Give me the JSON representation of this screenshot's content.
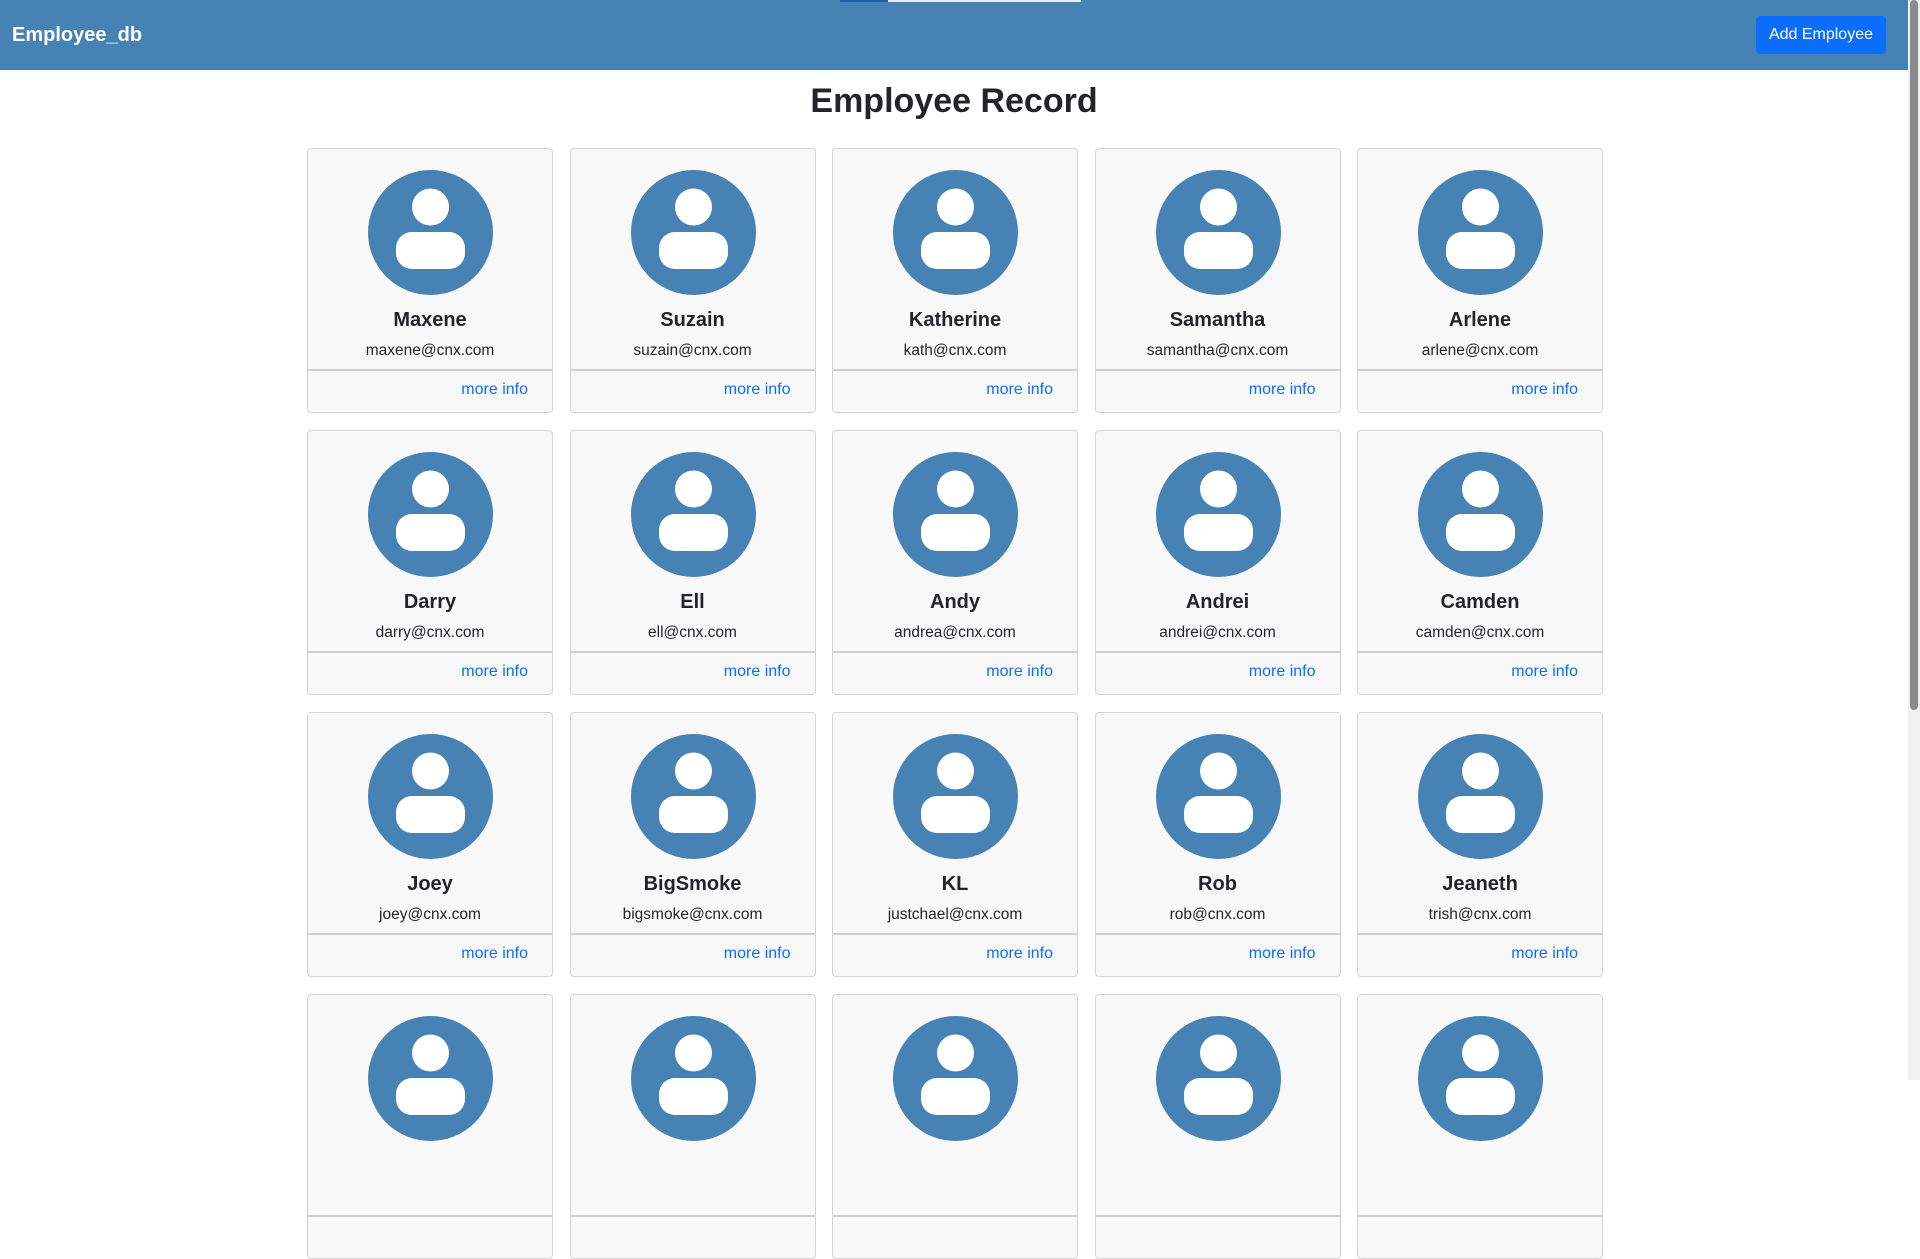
{
  "navbar": {
    "brand": "Employee_db",
    "add_button_label": "Add Employee",
    "color": "#4682b4",
    "button_color": "#0d6efd"
  },
  "page": {
    "title": "Employee Record"
  },
  "employees": [
    {
      "name": "Maxene",
      "email": "maxene@cnx.com",
      "link": "more info"
    },
    {
      "name": "Suzain",
      "email": "suzain@cnx.com",
      "link": "more info"
    },
    {
      "name": "Katherine",
      "email": "kath@cnx.com",
      "link": "more info"
    },
    {
      "name": "Samantha",
      "email": "samantha@cnx.com",
      "link": "more info"
    },
    {
      "name": "Arlene",
      "email": "arlene@cnx.com",
      "link": "more info"
    },
    {
      "name": "Darry",
      "email": "darry@cnx.com",
      "link": "more info"
    },
    {
      "name": "Ell",
      "email": "ell@cnx.com",
      "link": "more info"
    },
    {
      "name": "Andy",
      "email": "andrea@cnx.com",
      "link": "more info"
    },
    {
      "name": "Andrei",
      "email": "andrei@cnx.com",
      "link": "more info"
    },
    {
      "name": "Camden",
      "email": "camden@cnx.com",
      "link": "more info"
    },
    {
      "name": "Joey",
      "email": "joey@cnx.com",
      "link": "more info"
    },
    {
      "name": "BigSmoke",
      "email": "bigsmoke@cnx.com",
      "link": "more info"
    },
    {
      "name": "KL",
      "email": "justchael@cnx.com",
      "link": "more info"
    },
    {
      "name": "Rob",
      "email": "rob@cnx.com",
      "link": "more info"
    },
    {
      "name": "Jeaneth",
      "email": "trish@cnx.com",
      "link": "more info"
    },
    {
      "name": "",
      "email": "",
      "link": ""
    },
    {
      "name": "",
      "email": "",
      "link": ""
    },
    {
      "name": "",
      "email": "",
      "link": ""
    },
    {
      "name": "",
      "email": "",
      "link": ""
    },
    {
      "name": "",
      "email": "",
      "link": ""
    }
  ],
  "icons": {
    "avatar": "user-avatar-icon"
  }
}
